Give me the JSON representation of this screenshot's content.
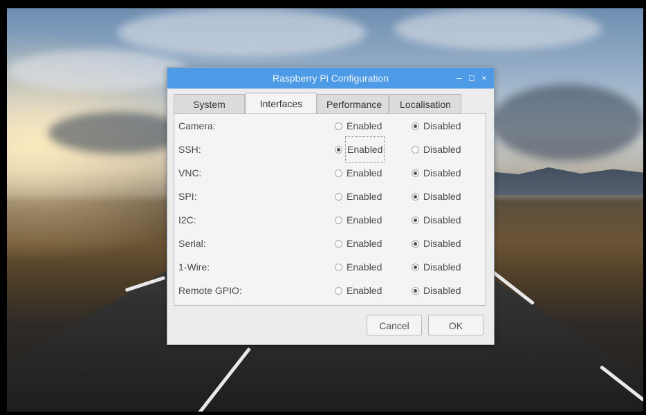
{
  "window": {
    "title": "Raspberry Pi Configuration",
    "controls": {
      "minimize": "–",
      "maximize": "□",
      "close": "×"
    }
  },
  "tabs": [
    {
      "label": "System",
      "active": false
    },
    {
      "label": "Interfaces",
      "active": true
    },
    {
      "label": "Performance",
      "active": false
    },
    {
      "label": "Localisation",
      "active": false
    }
  ],
  "interfaces": [
    {
      "label": "Camera:",
      "enabled_label": "Enabled",
      "disabled_label": "Disabled",
      "selected": "disabled"
    },
    {
      "label": "SSH:",
      "enabled_label": "Enabled",
      "disabled_label": "Disabled",
      "selected": "enabled"
    },
    {
      "label": "VNC:",
      "enabled_label": "Enabled",
      "disabled_label": "Disabled",
      "selected": "disabled"
    },
    {
      "label": "SPI:",
      "enabled_label": "Enabled",
      "disabled_label": "Disabled",
      "selected": "disabled"
    },
    {
      "label": "I2C:",
      "enabled_label": "Enabled",
      "disabled_label": "Disabled",
      "selected": "disabled"
    },
    {
      "label": "Serial:",
      "enabled_label": "Enabled",
      "disabled_label": "Disabled",
      "selected": "disabled"
    },
    {
      "label": "1-Wire:",
      "enabled_label": "Enabled",
      "disabled_label": "Disabled",
      "selected": "disabled"
    },
    {
      "label": "Remote GPIO:",
      "enabled_label": "Enabled",
      "disabled_label": "Disabled",
      "selected": "disabled"
    }
  ],
  "buttons": {
    "cancel": "Cancel",
    "ok": "OK"
  },
  "colors": {
    "titlebar": "#4d9be6",
    "window_bg": "#ececec"
  }
}
